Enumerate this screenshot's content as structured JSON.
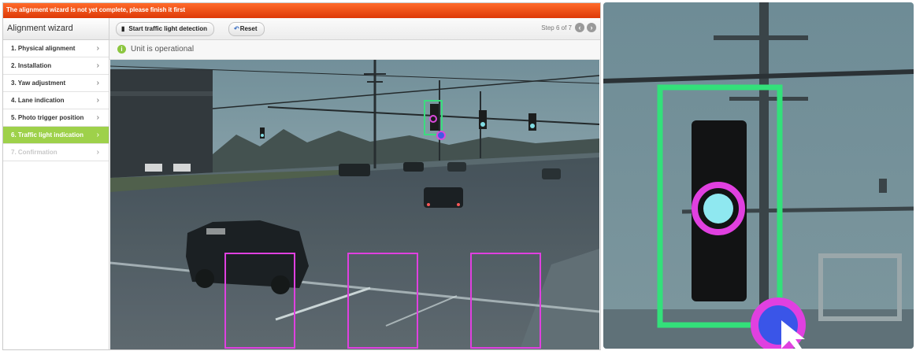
{
  "warning_bar": {
    "text": "The alignment wizard is not yet complete, please finish it first"
  },
  "sidebar": {
    "title": "Alignment wizard",
    "items": [
      {
        "label": "1. Physical alignment",
        "state": "normal"
      },
      {
        "label": "2. Installation",
        "state": "normal"
      },
      {
        "label": "3. Yaw adjustment",
        "state": "normal"
      },
      {
        "label": "4. Lane indication",
        "state": "normal"
      },
      {
        "label": "5. Photo trigger position",
        "state": "normal"
      },
      {
        "label": "6. Traffic light indication",
        "state": "active"
      },
      {
        "label": "7. Confirmation",
        "state": "disabled"
      }
    ],
    "chevron": "›"
  },
  "toolbar": {
    "start_label": "Start traffic light detection",
    "start_icon": "traffic-light-icon",
    "reset_label": "Reset",
    "reset_icon": "reset-icon",
    "step_text": "Step 6 of 7",
    "prev_icon": "chevron-left-icon",
    "next_icon": "chevron-right-icon"
  },
  "status": {
    "icon": "info-icon",
    "text": "Unit is operational"
  },
  "camera_view": {
    "lane_boxes": 3,
    "traffic_light_box": 1
  },
  "colors": {
    "warning_bar": "#e8501a",
    "active_step": "#9ed14a",
    "lane_box": "#e040e0",
    "traffic_light_box": "#33e07a",
    "marker": "#e040e0",
    "marker_fill": "#3a55e8"
  }
}
